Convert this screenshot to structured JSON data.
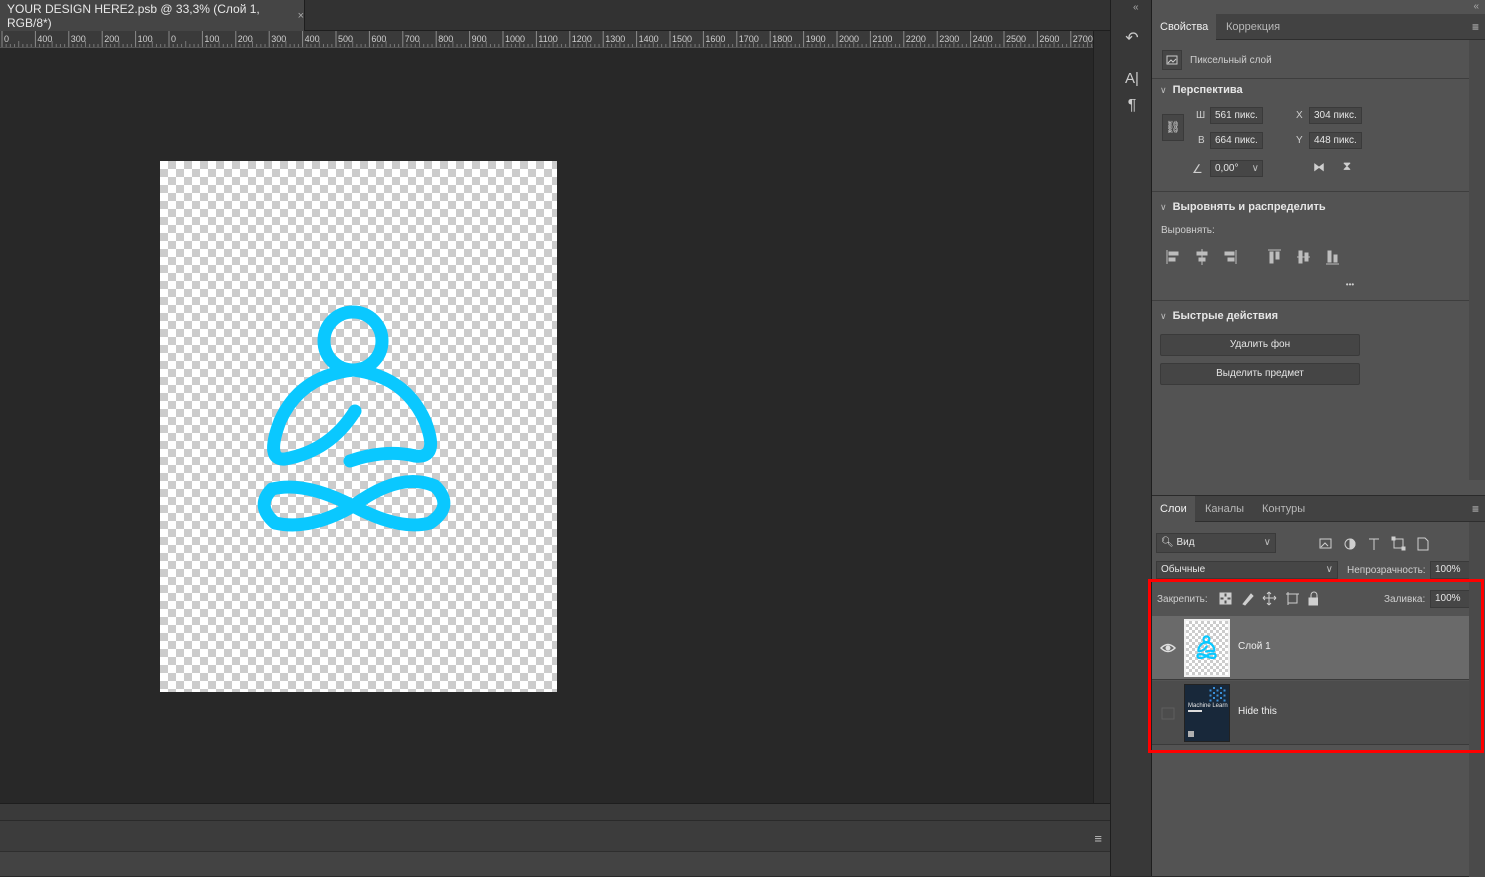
{
  "document": {
    "tab_title": "YOUR DESIGN HERE2.psb @ 33,3% (Слой 1, RGB/8*)",
    "close_glyph": "×",
    "ruler_ticks": [
      "0",
      "400",
      "300",
      "200",
      "100",
      "0",
      "100",
      "200",
      "300",
      "400",
      "500",
      "600",
      "700",
      "800",
      "900",
      "1000",
      "1100",
      "1200",
      "1300",
      "1400",
      "1500",
      "1600",
      "1700",
      "1800",
      "1900",
      "2000",
      "2100",
      "2200",
      "2300",
      "2400",
      "2500",
      "2600",
      "2700"
    ],
    "artwork_color": "#0ac8ff",
    "artwork_icon": "meditation-figure-icon",
    "bottom_menu_glyph": "≡"
  },
  "tool_strip": {
    "collapse_glyph": "«",
    "items": [
      {
        "name": "history-icon",
        "glyph": "↶"
      },
      {
        "name": "character-icon",
        "glyph": "A|"
      },
      {
        "name": "paragraph-icon",
        "glyph": "¶"
      }
    ]
  },
  "properties": {
    "panel_collapse_glyph": "«",
    "tabs": [
      "Свойства",
      "Коррекция"
    ],
    "menu_glyph": "≡",
    "layer_type": "Пиксельный слой",
    "transform": {
      "title": "Перспектива",
      "w_label": "Ш",
      "w_value": "561 пикс.",
      "h_label": "В",
      "h_value": "664 пикс.",
      "x_label": "X",
      "x_value": "304 пикс.",
      "y_label": "Y",
      "y_value": "448 пикс.",
      "angle_value": "0,00°"
    },
    "align": {
      "title": "Выровнять и распределить",
      "label": "Выровнять:",
      "more_glyph": "•••"
    },
    "quick_actions": {
      "title": "Быстрые действия",
      "remove_bg": "Удалить фон",
      "select_subject": "Выделить предмет"
    }
  },
  "layers": {
    "tabs": [
      "Слои",
      "Каналы",
      "Контуры"
    ],
    "menu_glyph": "≡",
    "filter_label": "Вид",
    "blend_mode": "Обычные",
    "opacity_label": "Непрозрачность:",
    "opacity_value": "100%",
    "lock_label": "Закрепить:",
    "fill_label": "Заливка:",
    "fill_value": "100%",
    "items": [
      {
        "name": "Слой 1",
        "visible": true,
        "selected": true
      },
      {
        "name": "Hide this",
        "visible": false,
        "selected": false
      }
    ],
    "thumb2_text": "Machine Learn"
  },
  "annotation": {
    "highlight_color": "#ff0000"
  }
}
